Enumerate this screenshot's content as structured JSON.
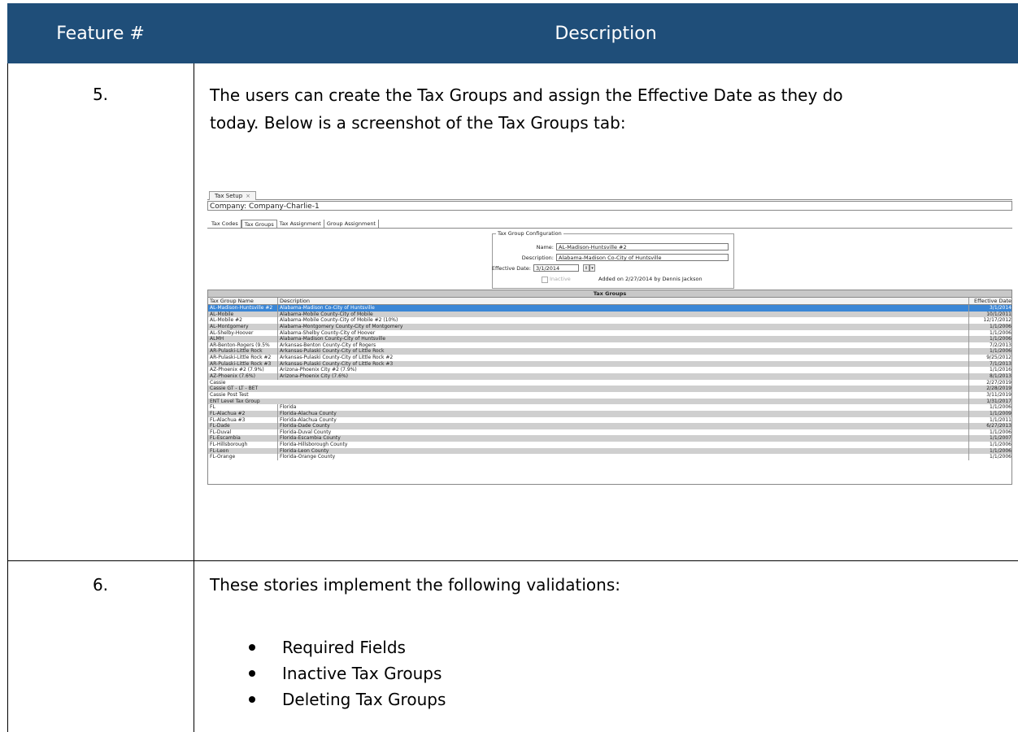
{
  "header": {
    "col1": "Feature #",
    "col2": "Description"
  },
  "rows": [
    {
      "num": "5.",
      "line1": "The users can create the Tax Groups and assign the Effective Date as they do",
      "line2": "today.  Below is a screenshot of the Tax Groups tab:"
    },
    {
      "num": "6.",
      "intro": "These stories implement the following validations:",
      "bullets": [
        "Required Fields",
        "Inactive Tax Groups",
        "Deleting Tax Groups"
      ]
    }
  ],
  "screenshot": {
    "doc_tab": "Tax Setup",
    "company": "Company: Company-Charlie-1",
    "tabs": [
      "Tax Codes",
      "Tax Groups",
      "Tax Assignment",
      "Group Assignment"
    ],
    "active_tab": "Tax Groups",
    "config": {
      "title": "Tax Group Configuration",
      "name_label": "Name:",
      "name_value": "AL-Madison-Huntsville #2",
      "desc_label": "Description:",
      "desc_value": "Alabama-Madison Co-City of Huntsville",
      "date_label": "Effective Date:",
      "date_value": "3/1/2014",
      "inactive_label": "Inactive",
      "added_text": "Added on 2/27/2014 by Dennis Jackson"
    },
    "grid": {
      "title": "Tax Groups",
      "columns": [
        "Tax Group Name",
        "Description",
        "Effective Date"
      ],
      "rows": [
        [
          "AL-Madison-Huntsville #2",
          "Alabama-Madison Co-City of Huntsville",
          "3/1/2014"
        ],
        [
          "AL-Mobile",
          "Alabama-Mobile County-City of Mobile",
          "10/1/2011"
        ],
        [
          "AL-Mobile #2",
          "Alabama-Mobile County-City of Mobile #2 (10%)",
          "12/17/2012"
        ],
        [
          "AL-Montgomery",
          "Alabama-Montgomery County-City of Montgomery",
          "1/1/2006"
        ],
        [
          "AL-Shelby-Hoover",
          "Alabama-Shelby County-City of Hoover",
          "1/1/2006"
        ],
        [
          "ALMH",
          "Alabama-Madison County-City of Huntsville",
          "1/1/2006"
        ],
        [
          "AR-Benton-Rogers (9.5%",
          "Arkansas-Benton County-City of Rogers",
          "7/2/2013"
        ],
        [
          "AR-Pulaski-Little Rock",
          "Arkansas-Pulaski County-City of Little Rock",
          "1/1/2006"
        ],
        [
          "AR-Pulaski-Little Rock #2",
          "Arkansas-Pulaski County-City of Little Rock #2",
          "9/25/2012"
        ],
        [
          "AR-Pulaski-Little Rock #3",
          "Arkansas-Pulaski County-City of Little Rock #3",
          "7/1/2013"
        ],
        [
          "AZ-Phoenix #2 (7.9%)",
          "Arizona-Phoenix City #2 (7.9%)",
          "1/1/2016"
        ],
        [
          "AZ-Phoenix (7.6%)",
          "Arizona-Phoenix City (7.6%)",
          "8/1/2013"
        ],
        [
          "Cassie",
          "",
          "2/27/2019"
        ],
        [
          "Cassie GT - LT - BET",
          "",
          "2/28/2019"
        ],
        [
          "Cassie Post Test",
          "",
          "3/11/2019"
        ],
        [
          "ENT Level Tax Group",
          "",
          "1/31/2017"
        ],
        [
          "FL",
          "Florida",
          "1/1/2006"
        ],
        [
          "FL-Alachua #2",
          "Florida-Alachua County",
          "1/1/2009"
        ],
        [
          "FL-Alachua #3",
          "Florida-Alachua County",
          "1/1/2011"
        ],
        [
          "FL-Dade",
          "Florida-Dade County",
          "6/27/2013"
        ],
        [
          "FL-Duval",
          "Florida-Duval County",
          "1/1/2006"
        ],
        [
          "FL-Escambia",
          "Florida-Escambia County",
          "1/1/2007"
        ],
        [
          "FL-Hillsborough",
          "Florida-Hillsborough County",
          "1/1/2006"
        ],
        [
          "FL-Leon",
          "Florida-Leon County",
          "1/1/2006"
        ],
        [
          "FL-Orange",
          "Florida-Orange County",
          "1/1/2006"
        ]
      ]
    }
  }
}
